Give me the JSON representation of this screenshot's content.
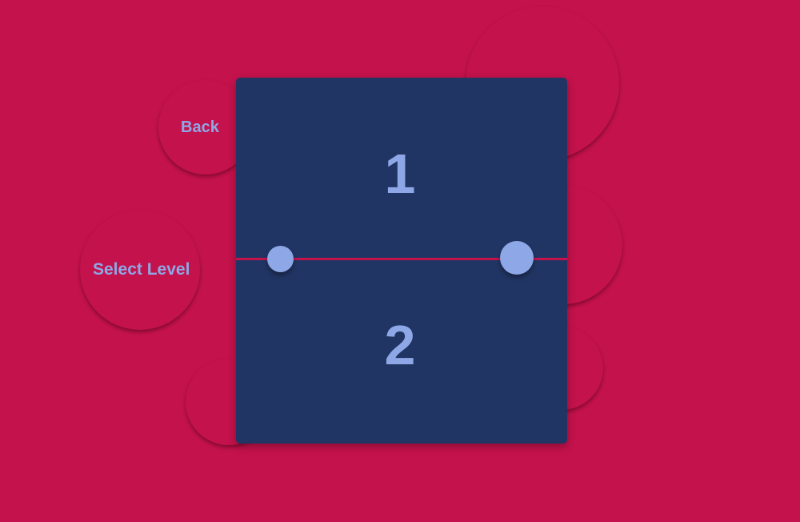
{
  "menu": {
    "back_label": "Back",
    "select_level_label": "Select Level"
  },
  "levels": [
    {
      "label": "1"
    },
    {
      "label": "2"
    }
  ],
  "colors": {
    "background": "#c4124c",
    "panel": "#213564",
    "accent": "#8ea7e6"
  }
}
